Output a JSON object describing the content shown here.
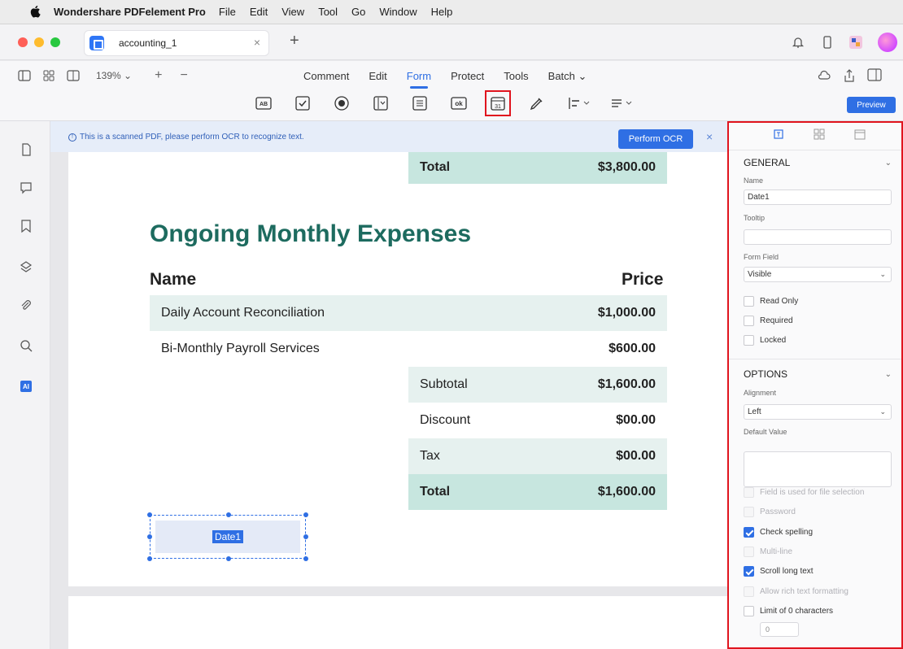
{
  "menubar": {
    "app_name": "Wondershare PDFelement Pro",
    "items": [
      "File",
      "Edit",
      "View",
      "Tool",
      "Go",
      "Window",
      "Help"
    ]
  },
  "tab": {
    "title": "accounting_1",
    "close": "×",
    "new": "+"
  },
  "toolbar": {
    "zoom": "139%",
    "zoom_in": "+",
    "zoom_out": "−",
    "nav": [
      "Comment",
      "Edit",
      "Form",
      "Protect",
      "Tools",
      "Batch"
    ],
    "active_nav": "Form",
    "form_tools": [
      "text-field-icon",
      "checkbox-icon",
      "radio-button-icon",
      "list-box-icon",
      "dropdown-icon",
      "button-icon",
      "date-field-icon",
      "signature-icon",
      "align-icon",
      "distribute-icon"
    ],
    "selected_tool": "date-field-icon",
    "form_tool_labels": {
      "text": "AB",
      "button": "ok",
      "date": "31"
    },
    "preview": "Preview",
    "accent": "#2f6fe4"
  },
  "ocr": {
    "message": "This is a scanned PDF, please perform OCR to recognize text.",
    "button": "Perform OCR",
    "close": "×"
  },
  "document": {
    "top_total_label": "Total",
    "top_total_value": "$3,800.00",
    "heading": "Ongoing Monthly Expenses",
    "col_name": "Name",
    "col_price": "Price",
    "rows": [
      {
        "name": "Daily Account Reconciliation",
        "price": "$1,000.00"
      },
      {
        "name": "Bi-Monthly Payroll Services",
        "price": "$600.00"
      }
    ],
    "summary": [
      {
        "label": "Subtotal",
        "value": "$1,600.00"
      },
      {
        "label": "Discount",
        "value": "$00.00"
      },
      {
        "label": "Tax",
        "value": "$00.00"
      },
      {
        "label": "Total",
        "value": "$1,600.00"
      }
    ],
    "field_name": "Date1",
    "heading_color": "#1d6b5f",
    "teal_dark": "#c7e6df",
    "teal_light": "#e6f1ef"
  },
  "panel": {
    "general": {
      "title": "GENERAL",
      "name_label": "Name",
      "name_value": "Date1",
      "tooltip_label": "Tooltip",
      "tooltip_value": "",
      "form_field_label": "Form Field",
      "form_field_value": "Visible",
      "checks": [
        {
          "label": "Read Only",
          "checked": false
        },
        {
          "label": "Required",
          "checked": false
        },
        {
          "label": "Locked",
          "checked": false
        }
      ]
    },
    "options": {
      "title": "OPTIONS",
      "alignment_label": "Alignment",
      "alignment_value": "Left",
      "default_label": "Default Value",
      "checks": [
        {
          "label": "Field is used for file selection",
          "checked": false,
          "disabled": true
        },
        {
          "label": "Password",
          "checked": false,
          "disabled": true
        },
        {
          "label": "Check spelling",
          "checked": true,
          "disabled": false
        },
        {
          "label": "Multi-line",
          "checked": false,
          "disabled": true
        },
        {
          "label": "Scroll long text",
          "checked": true,
          "disabled": false
        },
        {
          "label": "Allow rich text formatting",
          "checked": false,
          "disabled": true
        },
        {
          "label": "Limit of 0 characters",
          "checked": false,
          "disabled": false
        }
      ],
      "limit_value": "0"
    },
    "highlight": "#e0141e"
  }
}
